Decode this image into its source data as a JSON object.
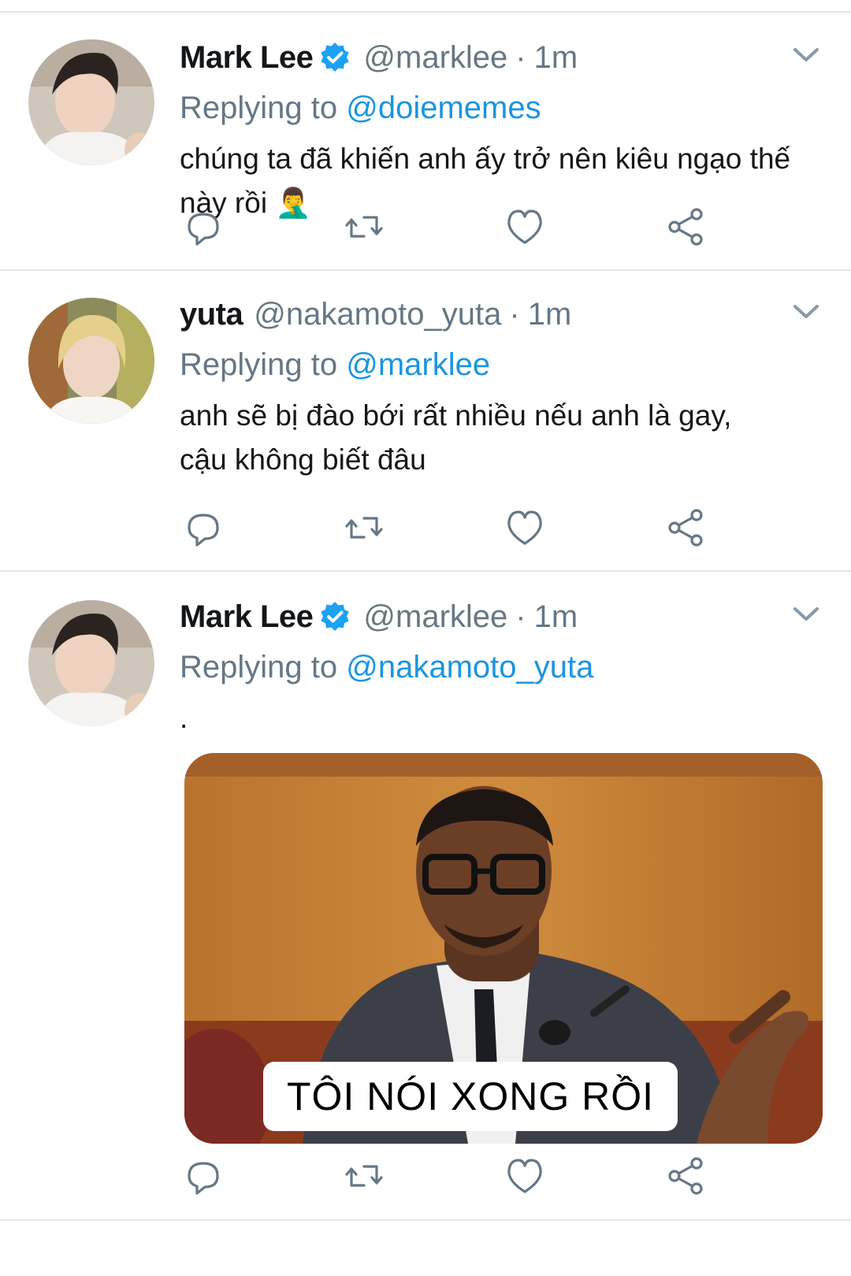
{
  "tweets": [
    {
      "name": "Mark Lee",
      "verified": true,
      "handle": "@marklee",
      "time": "1m",
      "replying_label": "Replying to",
      "replying_to": "@doiememes",
      "text": "chúng ta đã khiến anh ấy trở nên kiêu ngạo thế này rồi 🤦‍♂️"
    },
    {
      "name": "yuta",
      "verified": false,
      "handle": "@nakamoto_yuta",
      "time": "1m",
      "replying_label": "Replying to",
      "replying_to": "@marklee",
      "text": "anh sẽ bị đào bới rất nhiều nếu anh là gay, cậu không biết đâu"
    },
    {
      "name": "Mark Lee",
      "verified": true,
      "handle": "@marklee",
      "time": "1m",
      "replying_label": "Replying to",
      "replying_to": "@nakamoto_yuta",
      "text": ".",
      "media_caption": "TÔI NÓI XONG RỒI"
    }
  ],
  "separator": "·",
  "icons": {
    "verified": "verified-badge-icon",
    "caret": "chevron-down-icon",
    "reply": "reply-icon",
    "retweet": "retweet-icon",
    "like": "heart-icon",
    "share": "share-icon"
  },
  "colors": {
    "link": "#1b95e0",
    "secondary": "#657786",
    "verified": "#1da1f2"
  }
}
